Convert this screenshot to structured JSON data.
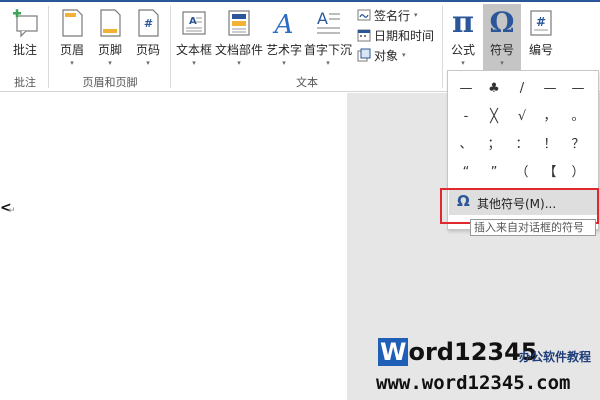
{
  "ribbon": {
    "groups": {
      "comment": {
        "button": "批注",
        "label": "批注"
      },
      "header_footer": {
        "label": "页眉和页脚",
        "header": "页眉",
        "footer": "页脚",
        "page_number": "页码"
      },
      "text": {
        "label": "文本",
        "textbox": "文本框",
        "quick_parts": "文档部件",
        "wordart": "艺术字",
        "dropcap": "首字下沉",
        "signature_line": "签名行",
        "date_time": "日期和时间",
        "object": "对象"
      },
      "symbols": {
        "equation": "公式",
        "symbol": "符号",
        "number": "编号"
      }
    }
  },
  "icons": {
    "equation": "π",
    "symbol": "Ω",
    "number": "#",
    "page_number": "#",
    "wordart": "A"
  },
  "document": {
    "cursor_char": "<",
    "paragraph_mark": "↵"
  },
  "symbol_menu": {
    "rows": [
      [
        "—",
        "♣",
        "/",
        "—",
        "—"
      ],
      [
        "-",
        "╳",
        "√",
        "，",
        "。"
      ],
      [
        "、",
        "；",
        "：",
        "！",
        "？"
      ],
      [
        "“",
        "”",
        "（",
        "【",
        "）"
      ]
    ],
    "more_label": "其他符号(M)...",
    "more_icon": "Ω",
    "tooltip": "插入来自对话框的符号"
  },
  "watermark": {
    "logo_w": "W",
    "logo_rest": "ord12345",
    "tagline": "办公软件教程",
    "url": "www.word12345.com"
  },
  "colors": {
    "accent": "#2b579a",
    "highlight_border": "#e0282e",
    "selected": "#c5c5c5"
  }
}
